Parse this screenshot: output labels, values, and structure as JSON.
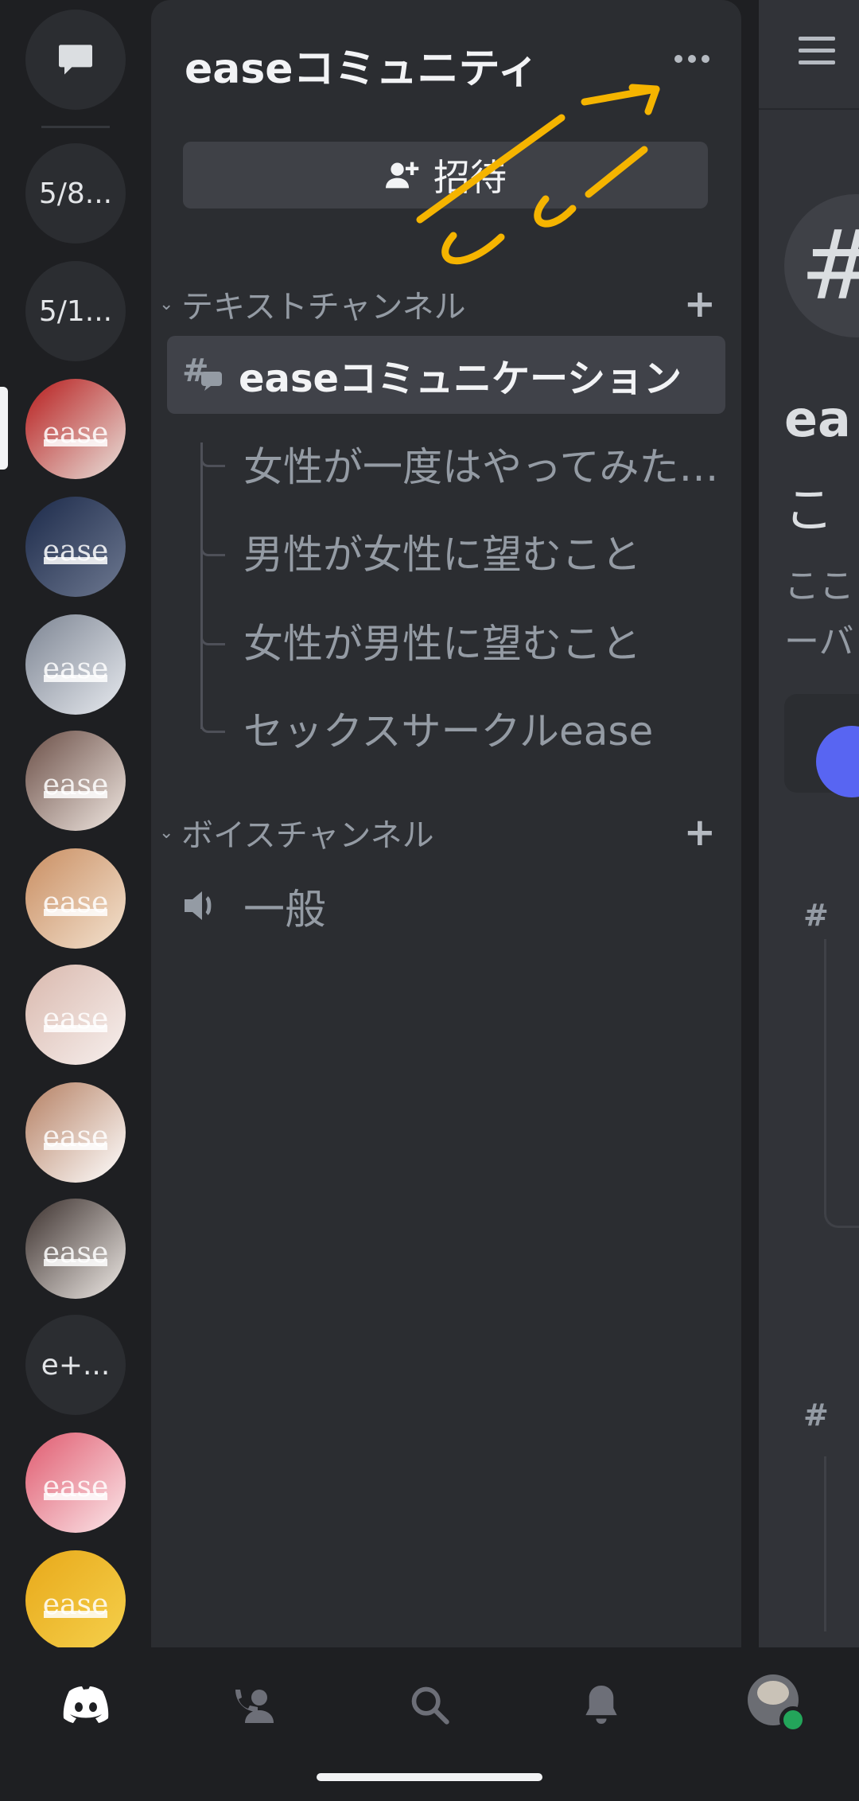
{
  "rail": {
    "dm_icon": "chat-bubble-icon",
    "folders": [
      "5/8...",
      "5/1..."
    ],
    "text_server": "e+...",
    "servers": [
      {
        "word": "ease",
        "colors": [
          "#b71c1c",
          "#e9e2dc"
        ]
      },
      {
        "word": "ease",
        "colors": [
          "#1c2a4a",
          "#6d7890"
        ]
      },
      {
        "word": "ease",
        "colors": [
          "#7d8593",
          "#e7eaef"
        ]
      },
      {
        "word": "ease",
        "colors": [
          "#6b4f47",
          "#f0e7e1"
        ]
      },
      {
        "word": "ease",
        "colors": [
          "#c98e62",
          "#f3e2cf"
        ]
      },
      {
        "word": "ease",
        "colors": [
          "#d9b8ad",
          "#f7f0ee"
        ]
      },
      {
        "word": "ease",
        "colors": [
          "#b58063",
          "#ffffff"
        ]
      },
      {
        "word": "ease",
        "colors": [
          "#3b302d",
          "#efeae6"
        ]
      },
      {
        "word": "ease",
        "colors": [
          "#e05b6f",
          "#fbe7ea"
        ]
      },
      {
        "word": "ease",
        "colors": [
          "#e8a91a",
          "#f5d04c"
        ]
      }
    ]
  },
  "panel": {
    "server_name": "easeコミュニティ",
    "invite_label": "招待",
    "text_category": "テキストチャンネル",
    "active_channel": "easeコミュニケーション",
    "threads": [
      "女性が一度はやってみたいこと",
      "男性が女性に望むこと",
      "女性が男性に望むこと",
      "セックスサークルease"
    ],
    "voice_category": "ボイスチャンネル",
    "voice_channel": "一般"
  },
  "peek": {
    "title_fragment": "ea",
    "line2_fragment": "こ",
    "sub1_fragment": "ここ",
    "sub2_fragment": "ーバ"
  },
  "nav": {
    "items": [
      "discord-logo-icon",
      "friends-icon",
      "search-icon",
      "bell-icon",
      "avatar"
    ]
  },
  "colors": {
    "annotation": "#f5b400",
    "online": "#23a55a"
  }
}
